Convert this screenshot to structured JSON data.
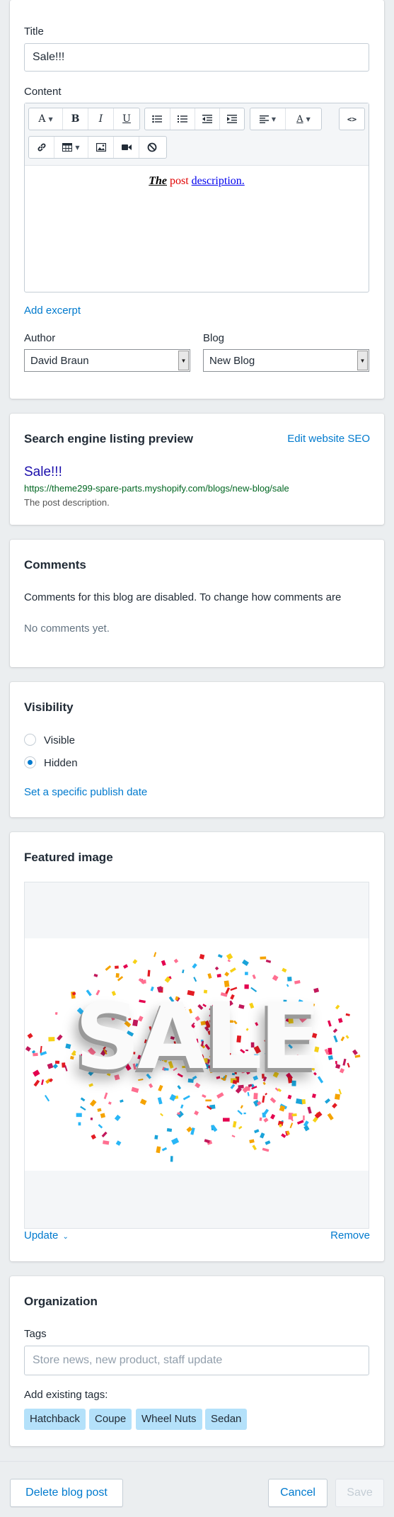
{
  "post": {
    "title_label": "Title",
    "title_value": "Sale!!!",
    "content_label": "Content",
    "content_bold": "The",
    "content_post": "post",
    "content_link": "description.",
    "add_excerpt": "Add excerpt",
    "author_label": "Author",
    "author_value": "David Braun",
    "blog_label": "Blog",
    "blog_value": "New Blog"
  },
  "toolbar": {
    "font_glyph": "A",
    "bold_glyph": "B",
    "italic_glyph": "I",
    "underline_glyph": "U",
    "code_glyph": "<>",
    "textcolor_glyph": "A"
  },
  "seo": {
    "heading": "Search engine listing preview",
    "edit_link": "Edit website SEO",
    "preview_title": "Sale!!!",
    "preview_url": "https://theme299-spare-parts.myshopify.com/blogs/new-blog/sale",
    "preview_desc": "The post description."
  },
  "comments": {
    "heading": "Comments",
    "disabled_text": "Comments for this blog are disabled. To change how comments are",
    "empty_text": "No comments yet."
  },
  "visibility": {
    "heading": "Visibility",
    "option_visible": "Visible",
    "option_hidden": "Hidden",
    "selected": "Hidden",
    "publish_date_link": "Set a specific publish date"
  },
  "featured": {
    "heading": "Featured image",
    "image_text": "SALE",
    "update_link": "Update",
    "remove_link": "Remove"
  },
  "organization": {
    "heading": "Organization",
    "tags_label": "Tags",
    "tags_placeholder": "Store news, new product, staff update",
    "existing_label": "Add existing tags:",
    "tags": [
      "Hatchback",
      "Coupe",
      "Wheel Nuts",
      "Sedan"
    ]
  },
  "footer": {
    "delete_label": "Delete blog post",
    "cancel_label": "Cancel",
    "save_label": "Save"
  },
  "colors": {
    "accent": "#007ace",
    "background": "#ebeef0",
    "tag_bg": "#b4e1fa",
    "seo_title": "#1a0dab",
    "seo_url": "#006621"
  }
}
